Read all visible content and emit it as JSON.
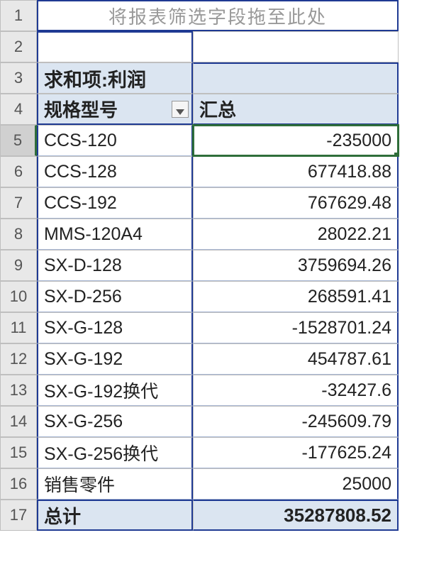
{
  "filterHint": "将报表筛选字段拖至此处",
  "pivot": {
    "measureLabel": "求和项:利润",
    "rowFieldLabel": "规格型号",
    "valueHeader": "汇总",
    "totalLabel": "总计",
    "totalValue": "35287808.52"
  },
  "rows": [
    {
      "n": "5",
      "label": "CCS-120",
      "value": "-235000"
    },
    {
      "n": "6",
      "label": "CCS-128",
      "value": "677418.88"
    },
    {
      "n": "7",
      "label": "CCS-192",
      "value": "767629.48"
    },
    {
      "n": "8",
      "label": "MMS-120A4",
      "value": "28022.21"
    },
    {
      "n": "9",
      "label": "SX-D-128",
      "value": "3759694.26"
    },
    {
      "n": "10",
      "label": "SX-D-256",
      "value": "268591.41"
    },
    {
      "n": "11",
      "label": "SX-G-128",
      "value": "-1528701.24"
    },
    {
      "n": "12",
      "label": "SX-G-192",
      "value": "454787.61"
    },
    {
      "n": "13",
      "label": "SX-G-192换代",
      "value": "-32427.6"
    },
    {
      "n": "14",
      "label": "SX-G-256",
      "value": "-245609.79"
    },
    {
      "n": "15",
      "label": "SX-G-256换代",
      "value": "-177625.24"
    },
    {
      "n": "16",
      "label": "销售零件",
      "value": "25000"
    }
  ],
  "rowNums": {
    "r1": "1",
    "r2": "2",
    "r3": "3",
    "r4": "4",
    "rTotal": "17"
  }
}
